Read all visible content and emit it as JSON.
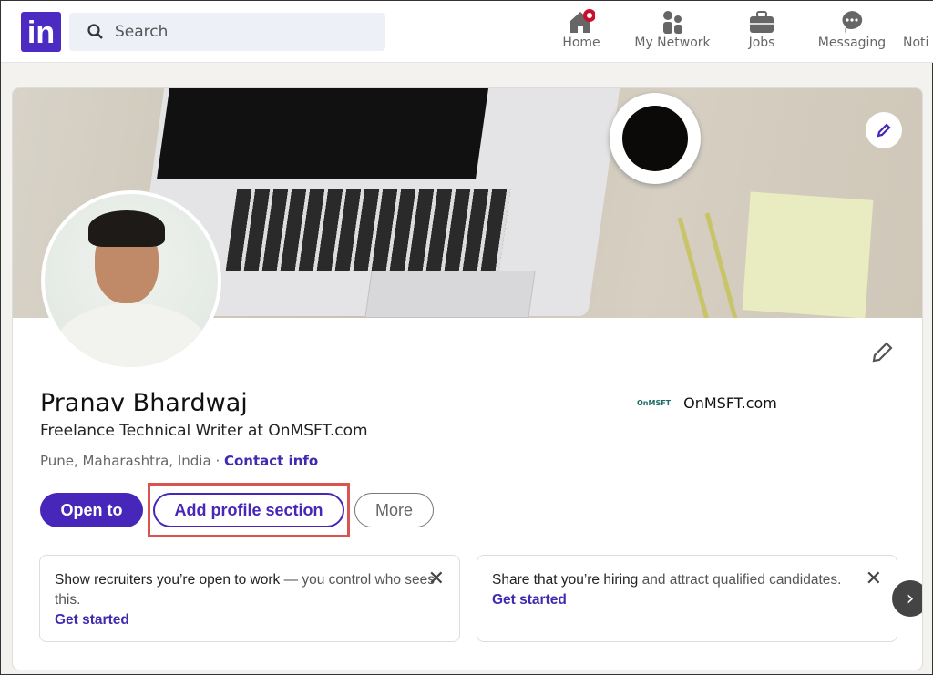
{
  "nav": {
    "search_placeholder": "Search",
    "items": [
      {
        "label": "Home",
        "icon": "home-icon"
      },
      {
        "label": "My Network",
        "icon": "network-icon"
      },
      {
        "label": "Jobs",
        "icon": "briefcase-icon"
      },
      {
        "label": "Messaging",
        "icon": "messaging-icon"
      },
      {
        "label": "Noti",
        "icon": "bell-icon"
      }
    ],
    "home_badge_color": "#c8102e"
  },
  "profile": {
    "name": "Pranav Bhardwaj",
    "headline": "Freelance Technical Writer at OnMSFT.com",
    "location": "Pune, Maharashtra, India",
    "separator": " · ",
    "contact_info": "Contact info",
    "company": "OnMSFT.com",
    "company_logo_text": "OnMSFT"
  },
  "buttons": {
    "open_to": "Open to",
    "add_section": "Add profile section",
    "more": "More"
  },
  "cards": [
    {
      "bold": "Show recruiters you’re open to work",
      "rest": " — you control who sees this.",
      "link": "Get started"
    },
    {
      "bold": "Share that you’re hiring",
      "rest": " and attract qualified candidates.",
      "link": "Get started"
    }
  ],
  "colors": {
    "brand": "#4b2bc2",
    "highlight": "#d9534f"
  }
}
